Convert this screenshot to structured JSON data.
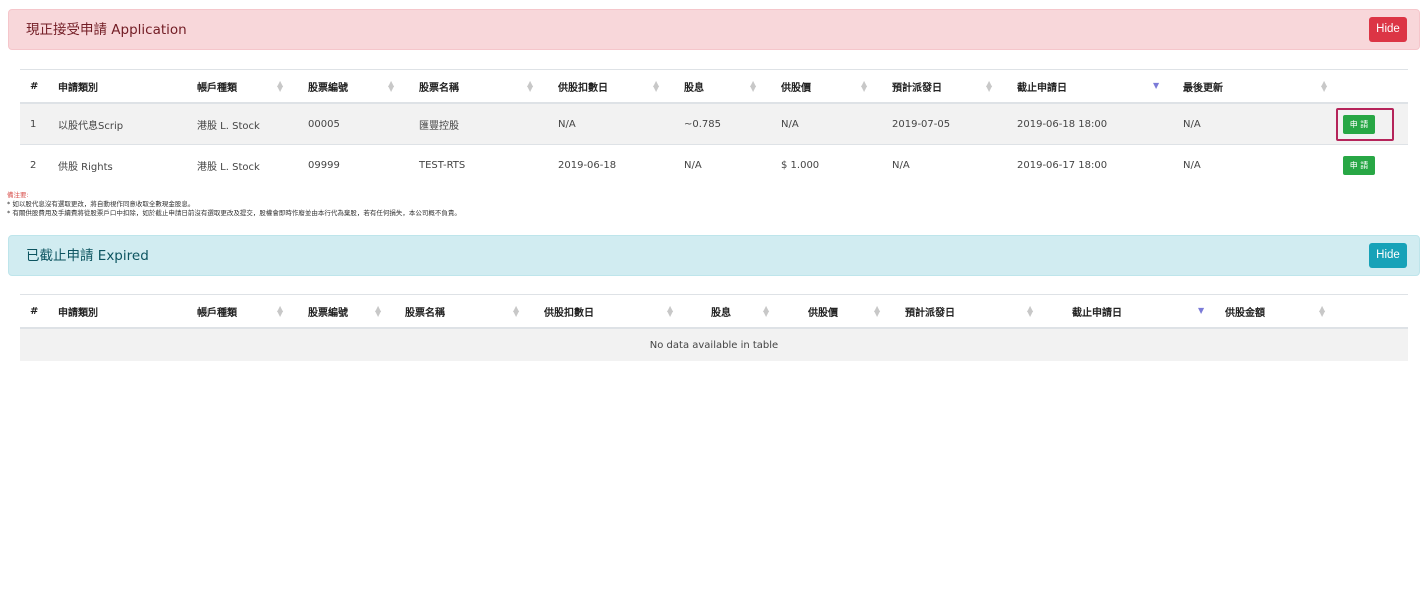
{
  "application_panel": {
    "title": "現正接受申請 Application",
    "hide_label": "Hide"
  },
  "application_table": {
    "headers": [
      "#",
      "申請類別",
      "帳戶種類",
      "股票編號",
      "股票名稱",
      "供股扣數日",
      "股息",
      "供股價",
      "預計派發日",
      "截止申請日",
      "最後更新",
      ""
    ],
    "rows": [
      {
        "cells": [
          "1",
          "以股代息Scrip",
          "港股 L. Stock",
          "00005",
          "匯豐控股",
          "N/A",
          "~0.785",
          "N/A",
          "2019-07-05",
          "2019-06-18 18:00",
          "N/A"
        ],
        "action": "申 請"
      },
      {
        "cells": [
          "2",
          "供股 Rights",
          "港股 L. Stock",
          "09999",
          "TEST-RTS",
          "2019-06-18",
          "N/A",
          "$ 1.000",
          "N/A",
          "2019-06-17 18:00",
          "N/A"
        ],
        "action": "申 請"
      }
    ]
  },
  "notes": {
    "title": "備注要:",
    "line1": "* 如以股代息沒有選取更改，將自動視作同意收取全數現金股息。",
    "line2": "* 有關供股費用及手續費將從股票戶口中扣除，如於截止申請日前沒有選取更改及提交，股權會即時作廢並由本行代為棄股，若有任何損失，本公司概不負責。"
  },
  "expired_panel": {
    "title": "已截止申請 Expired",
    "hide_label": "Hide"
  },
  "expired_table": {
    "headers": [
      "#",
      "申請類別",
      "帳戶種類",
      "股票編號",
      "股票名稱",
      "供股扣數日",
      "股息",
      "供股價",
      "預計派發日",
      "截止申請日",
      "供股金額",
      ""
    ],
    "empty_message": "No data available in table"
  },
  "colors": {
    "danger": "#dc3545",
    "info": "#17a2b8",
    "success": "#28a745",
    "highlight": "#b5245a"
  }
}
